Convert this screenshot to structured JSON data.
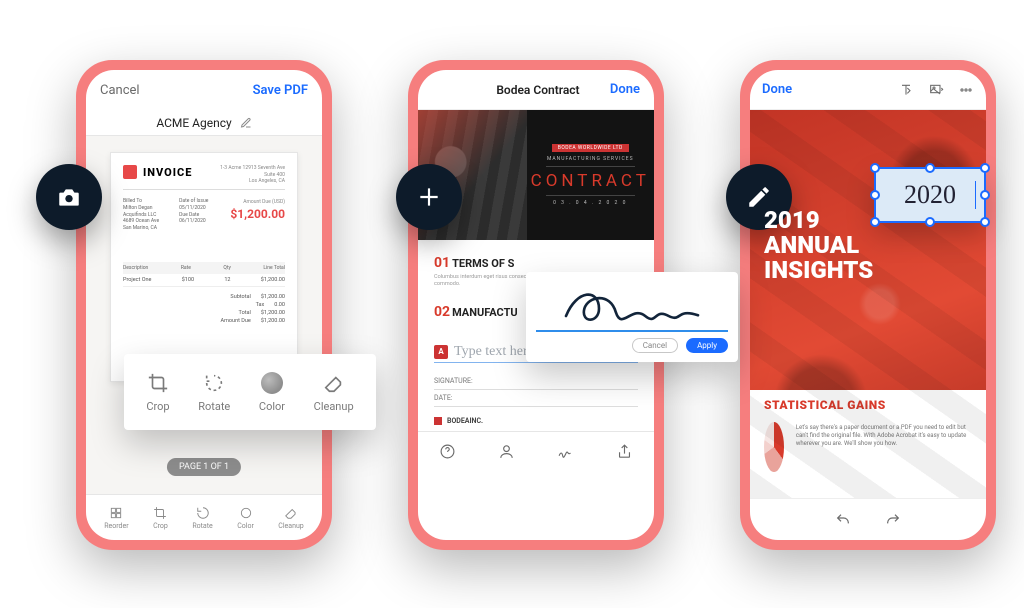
{
  "phone1": {
    "cancel": "Cancel",
    "save": "Save PDF",
    "doc_title": "ACME Agency",
    "invoice": {
      "title": "INVOICE",
      "addr": "1-3 Acme 12913 Seventh Ave\nSuite 400\nLos Angeles, CA",
      "billed_to": "Billed To\nMilton Degan\nAcquifinds LLC\n4689 Ocean Ave\nSan Marino, CA",
      "date_issue": "Date of Issue\n05/11/2020\nDue Date\n06/11/2020",
      "amount_lbl": "Amount Due (USD)",
      "amount": "$1,200.00",
      "th": {
        "desc": "Description",
        "qty": "Rate",
        "unit": "Qty",
        "total": "Line Total"
      },
      "row": {
        "desc": "Project One",
        "qty": "$100",
        "unit": "12",
        "total": "$1,200.00"
      },
      "totals": {
        "sub_l": "Subtotal",
        "sub_v": "$1,200.00",
        "tax_l": "Tax",
        "tax_v": "0.00",
        "tot_l": "Total",
        "tot_v": "$1,200.00",
        "due_l": "Amount Due",
        "due_v": "$1,200.00"
      }
    },
    "page_pill": "PAGE 1 OF 1",
    "nav": {
      "reorder": "Reorder",
      "crop": "Crop",
      "rotate": "Rotate",
      "color": "Color",
      "cleanup": "Cleanup"
    }
  },
  "toolcard": {
    "crop": "Crop",
    "rotate": "Rotate",
    "color": "Color",
    "cleanup": "Cleanup"
  },
  "phone2": {
    "title": "Bodea Contract",
    "done": "Done",
    "hero": {
      "badge1": "BODEA WORLDWIDE LTD",
      "badge2": "MANUFACTURING SERVICES",
      "big": "CONTRACT",
      "date": "0 3 . 0 4 . 2 0 2 0"
    },
    "sec1": {
      "num": "01",
      "lbl": "TERMS OF S",
      "blurb": "Columbus interdum eget risus consectetur facilisis pharetra behicula class commodo."
    },
    "sec2": {
      "num": "02",
      "lbl": "MANUFACTU"
    },
    "placeholder": "Type text here",
    "sig_lbl": "SIGNATURE:",
    "date_lbl": "DATE:",
    "brand": "BODEAINC."
  },
  "sigcard": {
    "cancel": "Cancel",
    "apply": "Apply"
  },
  "phone3": {
    "done": "Done",
    "cover_title": "2019\nANNUAL\nINSIGHTS",
    "heading": "STATISTICAL GAINS",
    "para": "Let's say there's a paper document or a PDF you need to edit but can't find the original file. With Adobe Acrobat it's easy to update wherever you are. We'll show you how."
  },
  "yearchip": "2020"
}
